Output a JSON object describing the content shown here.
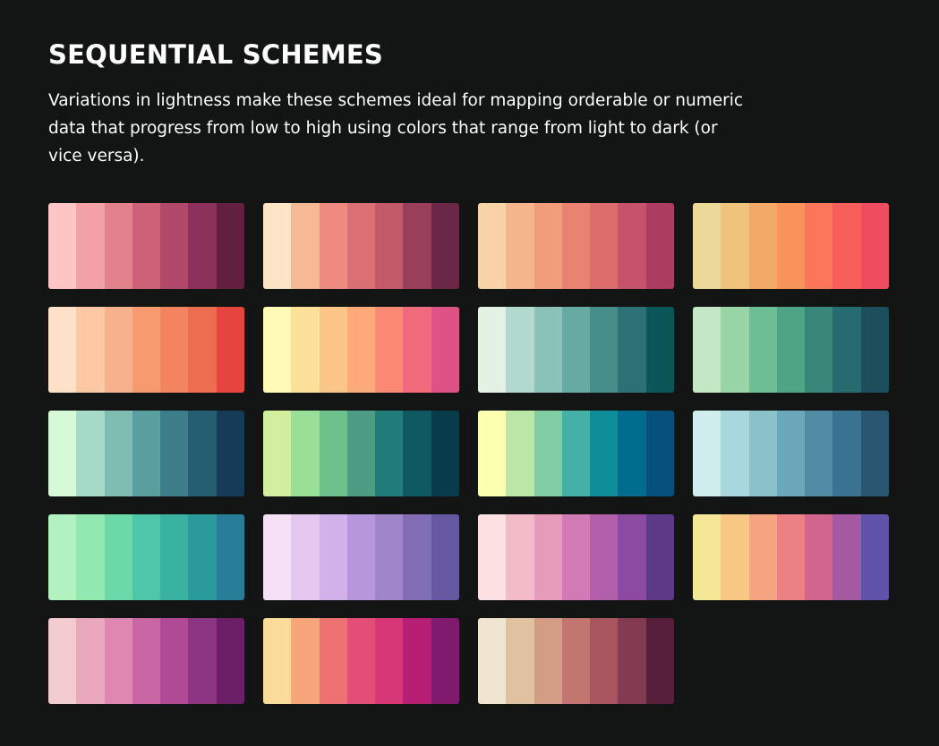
{
  "header": {
    "title": "SEQUENTIAL SCHEMES",
    "description": "Variations in lightness make these schemes ideal for mapping orderable or numeric data that progress from low to high using colors that range from light to dark (or vice versa)."
  },
  "palettes": [
    [
      "#fdc5c4",
      "#f2a2a7",
      "#e3818c",
      "#cd6177",
      "#b14a6a",
      "#8d305a",
      "#621f40"
    ],
    [
      "#fee4c6",
      "#f6b994",
      "#ef8a80",
      "#db7074",
      "#c25a6a",
      "#993f59",
      "#6b2746"
    ],
    [
      "#f7d3a7",
      "#f5b68e",
      "#f19c7b",
      "#e88372",
      "#dd6c6d",
      "#c6536a",
      "#ac3c60"
    ],
    [
      "#ecd99a",
      "#f0c37c",
      "#f3aa68",
      "#f8935c",
      "#fa7859",
      "#f75f5a",
      "#ed4d5e"
    ],
    [
      "#fee1c8",
      "#fdc8a3",
      "#f8b18d",
      "#f69a70",
      "#f2855f",
      "#ec6d4f",
      "#e6453f"
    ],
    [
      "#fffab6",
      "#fee199",
      "#fec589",
      "#fda97a",
      "#fa8a73",
      "#f06a7c",
      "#de5286"
    ],
    [
      "#e4f2e4",
      "#b2d9cd",
      "#8ac2b8",
      "#67a9a3",
      "#478d89",
      "#2d7174",
      "#0b5758"
    ],
    [
      "#c4e8c6",
      "#98d4a6",
      "#6dbf93",
      "#50a486",
      "#388779",
      "#266c6e",
      "#1d4e5c"
    ],
    [
      "#d6fad8",
      "#a5d9c8",
      "#7fbcb1",
      "#589f9e",
      "#3e7e8a",
      "#265e71",
      "#143b57"
    ],
    [
      "#d2ef9f",
      "#9adf97",
      "#6cc18d",
      "#4d9d85",
      "#217d79",
      "#0f5a62",
      "#093c4a"
    ],
    [
      "#fbffb0",
      "#bae6a7",
      "#80cda4",
      "#45b1a6",
      "#0e8e98",
      "#006d8f",
      "#06507c"
    ],
    [
      "#d0eeeb",
      "#a8d8dd",
      "#8bc1c9",
      "#6ba9ba",
      "#508da5",
      "#3a7291",
      "#2b5671"
    ],
    [
      "#b2f1c0",
      "#91e9b0",
      "#6bdaa8",
      "#4fc6a5",
      "#39b2a2",
      "#2a9a9d",
      "#287d98"
    ],
    [
      "#f5e0f6",
      "#e4c8f0",
      "#d2b0ea",
      "#b797dc",
      "#a085ca",
      "#816eb5",
      "#6658a0"
    ],
    [
      "#fde0e1",
      "#f3bbc8",
      "#e69bbb",
      "#d27ab6",
      "#b35fab",
      "#8d4aa1",
      "#5e3988"
    ],
    [
      "#f4e796",
      "#f8c884",
      "#f6a482",
      "#eb8185",
      "#d1658e",
      "#a35aa1",
      "#6152aa"
    ],
    [
      "#f3ccd1",
      "#eaa8bf",
      "#dd87b1",
      "#c966a4",
      "#b04a94",
      "#8c3582",
      "#6a1f67"
    ],
    [
      "#fbdb99",
      "#f7a57a",
      "#ee7272",
      "#e24e75",
      "#d83776",
      "#b61f73",
      "#801a6e"
    ],
    [
      "#f0e5d0",
      "#e0c2a1",
      "#d39c85",
      "#c27670",
      "#a8555f",
      "#833b51",
      "#581f3b"
    ]
  ]
}
